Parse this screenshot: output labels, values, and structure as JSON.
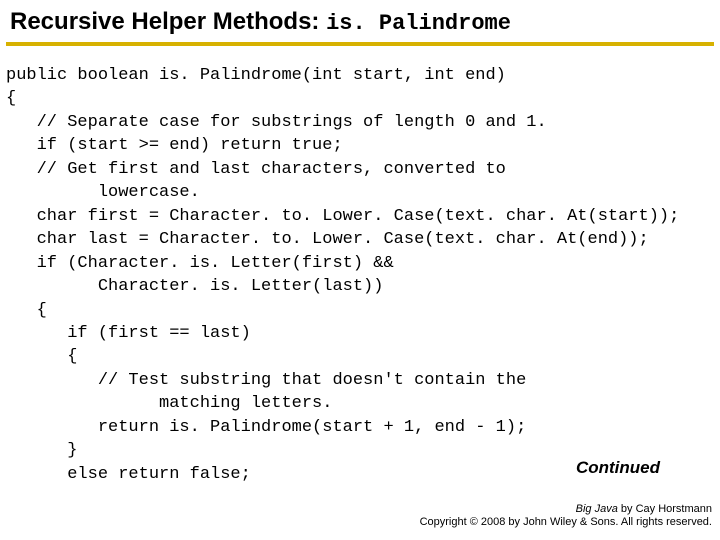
{
  "title": {
    "prefix": "Recursive Helper Methods: ",
    "code": "is. Palindrome"
  },
  "code_lines": [
    "public boolean is. Palindrome(int start, int end)",
    "{",
    "   // Separate case for substrings of length 0 and 1.",
    "   if (start >= end) return true;",
    "   // Get first and last characters, converted to",
    "         lowercase.",
    "   char first = Character. to. Lower. Case(text. char. At(start));",
    "   char last = Character. to. Lower. Case(text. char. At(end));",
    "   if (Character. is. Letter(first) &&",
    "         Character. is. Letter(last))",
    "   {",
    "      if (first == last)",
    "      {",
    "         // Test substring that doesn't contain the",
    "               matching letters.",
    "         return is. Palindrome(start + 1, end - 1);",
    "      }",
    "      else return false;"
  ],
  "continued_label": "Continued",
  "footer": {
    "book_title": "Big Java",
    "by_author": " by Cay Horstmann",
    "copyright": "Copyright © 2008 by John Wiley & Sons.  All rights reserved."
  }
}
